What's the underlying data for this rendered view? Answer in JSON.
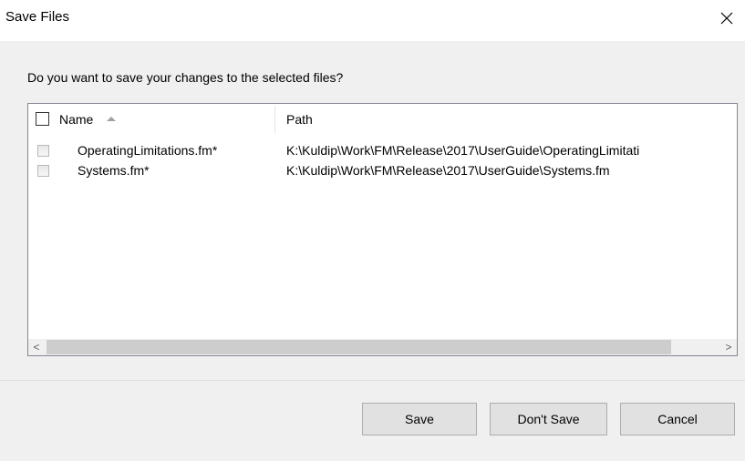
{
  "window": {
    "title": "Save Files",
    "close_glyph": "✕"
  },
  "prompt": "Do you want to save your changes to the selected files?",
  "list": {
    "columns": {
      "name": "Name",
      "path": "Path"
    },
    "sort": {
      "column": "name",
      "direction": "ascending"
    },
    "rows": [
      {
        "name": "OperatingLimitations.fm*",
        "path": "K:\\Kuldip\\Work\\FM\\Release\\2017\\UserGuide\\OperatingLimitati",
        "checked": false
      },
      {
        "name": "Systems.fm*",
        "path": "K:\\Kuldip\\Work\\FM\\Release\\2017\\UserGuide\\Systems.fm",
        "checked": false
      }
    ],
    "scroll_left_glyph": "<",
    "scroll_right_glyph": ">"
  },
  "buttons": {
    "save": "Save",
    "dont_save": "Don't Save",
    "cancel": "Cancel"
  },
  "colors": {
    "dialog_bg": "#f0f0f0",
    "title_bg": "#ffffff",
    "button_bg": "#e1e1e1",
    "button_border": "#adadad",
    "list_border": "#828790"
  }
}
